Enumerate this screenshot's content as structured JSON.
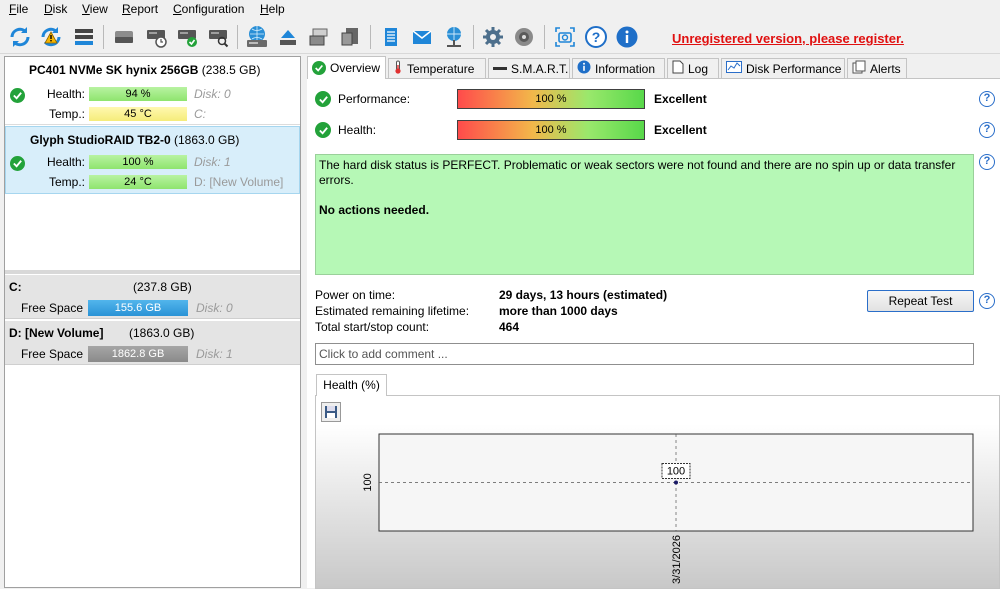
{
  "menu": [
    "File",
    "Disk",
    "View",
    "Report",
    "Configuration",
    "Help"
  ],
  "toolbar": {
    "icons": [
      "refresh-icon",
      "refresh-warning-icon",
      "disk-list-icon",
      "disk-gray-icon",
      "disk-clock-icon",
      "disk-check-icon",
      "disk-search-icon",
      "hdd-globe-icon",
      "eject-icon",
      "disk-stack-icon",
      "disk-drive-icon",
      "notepad-icon",
      "email-icon",
      "network-icon",
      "settings-icon",
      "speaker-icon",
      "screenshot-icon",
      "help-icon",
      "info-icon"
    ],
    "register_text": "Unregistered version, please register."
  },
  "disks": [
    {
      "name": "PC401 NVMe SK hynix 256GB",
      "size": "(238.5 GB)",
      "health_label": "Health:",
      "health": "94 %",
      "health_pct": 94,
      "temp_label": "Temp.:",
      "temp": "45 °C",
      "info1": "Disk: 0",
      "info2": "C:"
    },
    {
      "name": "Glyph  StudioRAID TB2-0",
      "size": "(1863.0 GB)",
      "health_label": "Health:",
      "health": "100 %",
      "health_pct": 100,
      "temp_label": "Temp.:",
      "temp": "24 °C",
      "info1": "Disk: 1",
      "info2_main": "D:",
      "info2_rest": "[New Volume]"
    }
  ],
  "volumes": [
    {
      "name": "C:",
      "size": "(237.8 GB)",
      "free_label": "Free Space",
      "free": "155.6 GB",
      "disk": "Disk: 0"
    },
    {
      "name": "D: [New Volume]",
      "size": "(1863.0 GB)",
      "free_label": "Free Space",
      "free": "1862.8 GB",
      "disk": "Disk: 1"
    }
  ],
  "tabs": [
    {
      "label": "Overview",
      "icon": "check-icon",
      "active": true
    },
    {
      "label": "Temperature",
      "icon": "thermometer-icon"
    },
    {
      "label": "S.M.A.R.T.",
      "icon": "smart-icon"
    },
    {
      "label": "Information",
      "icon": "info-icon"
    },
    {
      "label": "Log",
      "icon": "log-icon"
    },
    {
      "label": "Disk Performance",
      "icon": "chart-icon"
    },
    {
      "label": "Alerts",
      "icon": "alerts-icon"
    }
  ],
  "overview": {
    "performance_label": "Performance:",
    "performance_value": "100 %",
    "performance_status": "Excellent",
    "health_label": "Health:",
    "health_value": "100 %",
    "health_status": "Excellent",
    "status_line1": "The hard disk status is PERFECT. Problematic or weak sectors were not found and there are no spin up or data transfer errors.",
    "status_line2": "No actions needed.",
    "power_on_label": "Power on time:",
    "power_on_value": "29 days, 13 hours (estimated)",
    "lifetime_label": "Estimated remaining lifetime:",
    "lifetime_value": "more than 1000 days",
    "startstop_label": "Total start/stop count:",
    "startstop_value": "464",
    "repeat_button": "Repeat Test",
    "comment_placeholder": "Click to add comment ..."
  },
  "chart_tab": "Health (%)",
  "chart_data": {
    "type": "line",
    "x": [
      "3/31/2026"
    ],
    "series": [
      {
        "values": [
          100
        ]
      }
    ],
    "ytick": "100",
    "point_label": "100"
  },
  "colors": {
    "accent": "#2a6ec9",
    "ok": "#23a23a",
    "register": "#e01010",
    "status_bg": "#b6f8b6"
  }
}
